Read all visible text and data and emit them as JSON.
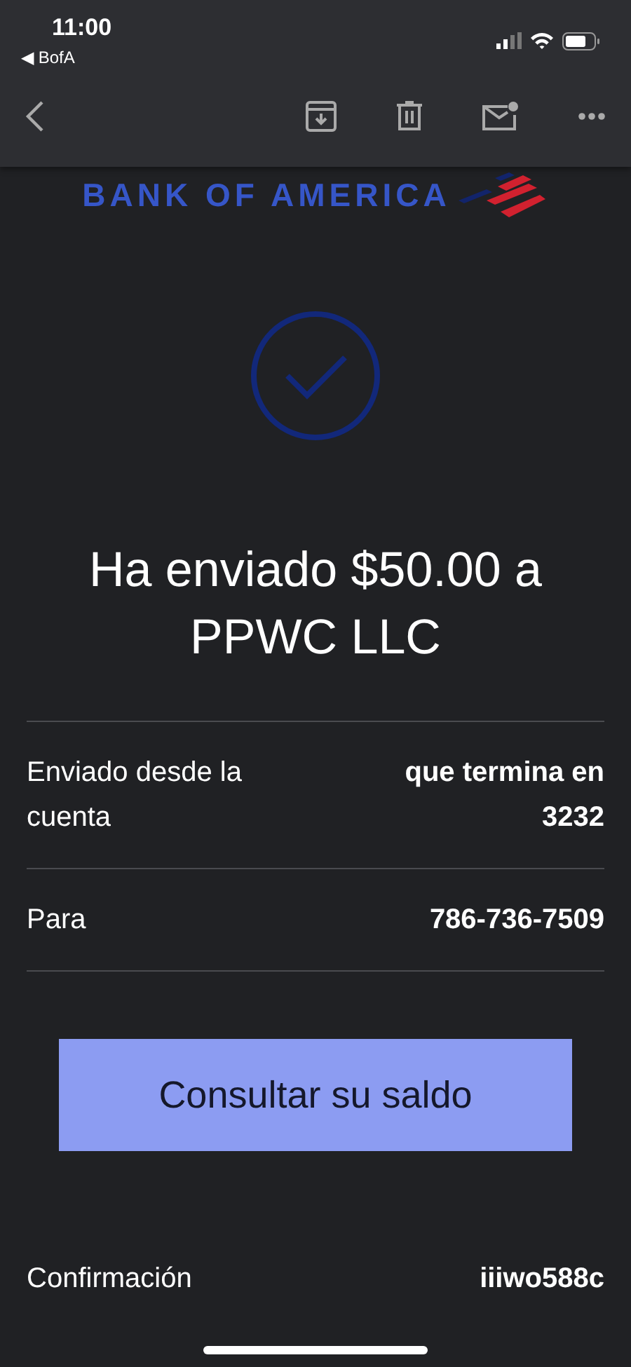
{
  "status_bar": {
    "time": "11:00",
    "back_app": "◀ BofA"
  },
  "logo": {
    "text": "BANK OF AMERICA"
  },
  "headline": "Ha enviado $50.00 a PPWC LLC",
  "details": [
    {
      "label": "Enviado desde la cuenta",
      "value": "que termina en 3232"
    },
    {
      "label": "Para",
      "value": "786-736-7509"
    }
  ],
  "button": "Consultar su saldo",
  "confirmation": {
    "label": "Confirmación",
    "value": "iiiwo588c"
  }
}
